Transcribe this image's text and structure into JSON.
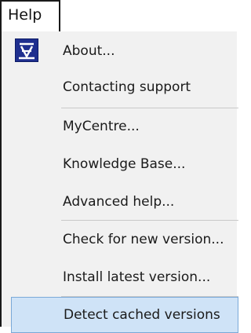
{
  "menubar": {
    "title": "Help"
  },
  "menu": {
    "items": [
      {
        "label": "About...",
        "icon": "about-icon"
      },
      {
        "label": "Contacting support"
      },
      {
        "label": "MyCentre..."
      },
      {
        "label": "Knowledge Base..."
      },
      {
        "label": "Advanced help..."
      },
      {
        "label": "Check for new version..."
      },
      {
        "label": "Install latest version..."
      },
      {
        "label": "Detect cached versions",
        "highlighted": true
      }
    ]
  },
  "colors": {
    "highlight_background": "#cfe3f7",
    "highlight_border": "#7aa9d8",
    "icon_background": "#1f2f8f"
  }
}
